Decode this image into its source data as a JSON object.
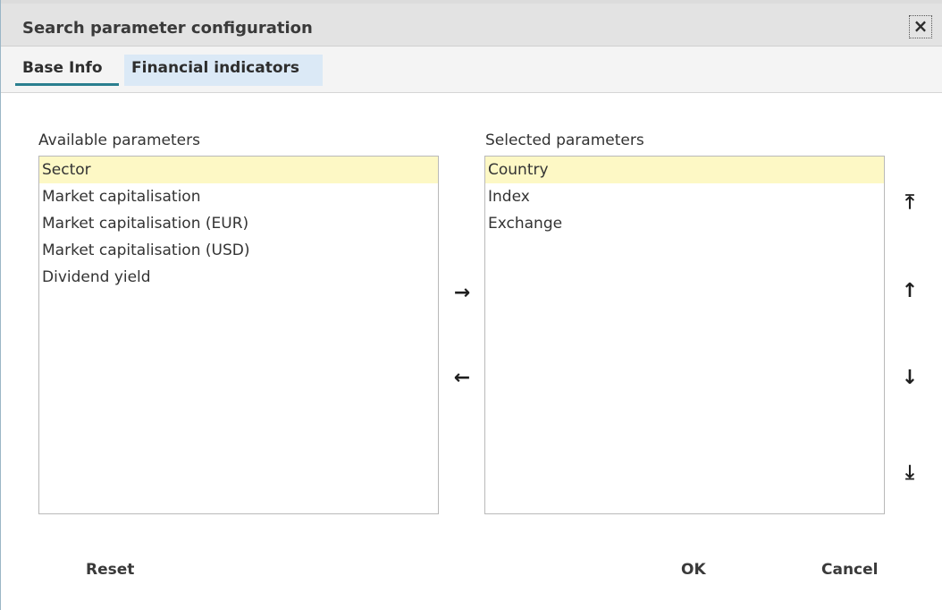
{
  "dialog": {
    "title": "Search parameter configuration",
    "close_label": "×"
  },
  "tabs": [
    {
      "label": "Base Info",
      "active": true
    },
    {
      "label": "Financial indicators",
      "active": false
    }
  ],
  "available": {
    "label": "Available parameters",
    "items": [
      "Sector",
      "Market capitalisation",
      "Market capitalisation (EUR)",
      "Market capitalisation (USD)",
      "Dividend yield"
    ],
    "selected_index": 0
  },
  "selected": {
    "label": "Selected parameters",
    "items": [
      "Country",
      "Index",
      "Exchange"
    ],
    "selected_index": 0
  },
  "transfer": {
    "add_icon": "→",
    "remove_icon": "←"
  },
  "order": {
    "top_icon": "⤒",
    "up_icon": "↑",
    "down_icon": "↓",
    "bottom_icon": "⤓"
  },
  "buttons": {
    "reset": "Reset",
    "ok": "OK",
    "cancel": "Cancel"
  },
  "colors": {
    "selection": "#fdf8c5",
    "tab_accent": "#2a7f8f",
    "tab_highlight": "#dbe9f6"
  }
}
